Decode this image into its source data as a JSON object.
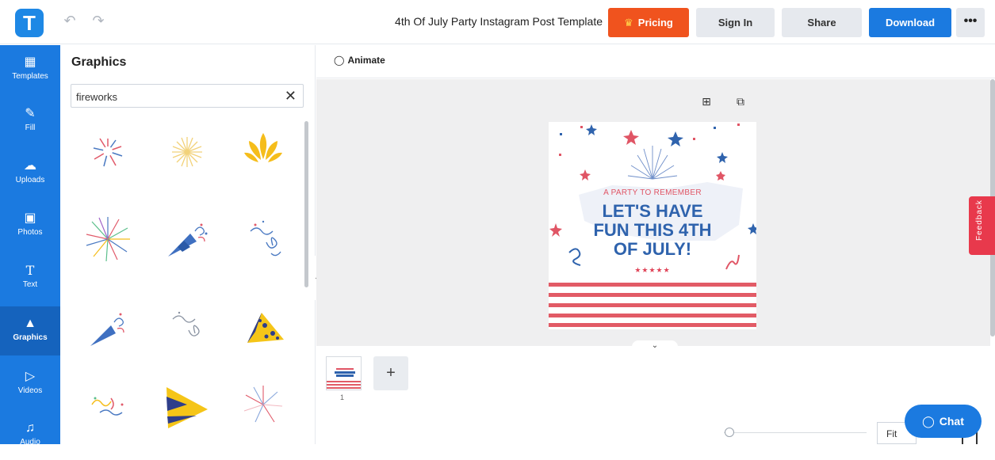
{
  "app": {
    "logo": "T",
    "undo_icon": "undo-icon",
    "redo_icon": "redo-icon"
  },
  "header": {
    "doc_title": "4th Of July Party Instagram Post Template",
    "pricing_label": "Pricing",
    "signin_label": "Sign In",
    "share_label": "Share",
    "download_label": "Download",
    "more_label": "•••"
  },
  "sidebar": {
    "items": [
      {
        "label": "Templates",
        "icon": "templates-icon"
      },
      {
        "label": "Fill",
        "icon": "pen-icon"
      },
      {
        "label": "Uploads",
        "icon": "cloud-upload-icon"
      },
      {
        "label": "Photos",
        "icon": "image-icon"
      },
      {
        "label": "Text",
        "icon": "text-icon"
      },
      {
        "label": "Graphics",
        "icon": "shapes-icon",
        "active": true
      },
      {
        "label": "Videos",
        "icon": "video-icon"
      },
      {
        "label": "Audio",
        "icon": "music-icon"
      }
    ]
  },
  "graphics_panel": {
    "title": "Graphics",
    "search_value": "fireworks",
    "results": [
      "firework-burst-red-blue",
      "firework-burst-yellow",
      "firework-yellow-splash",
      "firework-burst-multicolor",
      "party-popper-blue",
      "confetti-streamers-blue",
      "party-popper-blue-small",
      "confetti-streamers-gray",
      "party-hat-dots",
      "confetti-multicolor",
      "party-hat-striped",
      "firework-burst-pastel"
    ]
  },
  "toolbar": {
    "animate_label": "Animate"
  },
  "canvas": {
    "add_icon": "add-page-icon",
    "copy_icon": "duplicate-icon",
    "design": {
      "subtitle": "A PARTY TO REMEMBER",
      "headline_line1": "LET'S HAVE",
      "headline_line2": "FUN THIS 4TH",
      "headline_line3": "OF JULY!",
      "stars": "★★★★★",
      "accent_red": "#e25b66",
      "accent_blue": "#2f63ad"
    },
    "feedback_label": "Feedback"
  },
  "pages": {
    "page_number": "1",
    "add_label": "+"
  },
  "footer": {
    "zoom_mode": "Fit",
    "chat_label": "Chat"
  },
  "colors": {
    "brand_blue": "#1b7ae0",
    "pricing_orange": "#f0531e",
    "feedback_red": "#e8394c"
  }
}
